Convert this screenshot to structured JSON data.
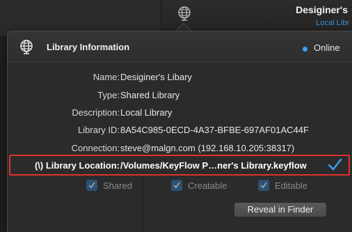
{
  "background_window": {
    "title": "Desiginer's",
    "subtitle": "Local Libr",
    "icon": "globe-icon"
  },
  "popover": {
    "header": {
      "icon": "globe-icon",
      "title": "Library Information",
      "status_text": "Online",
      "status_color": "#3fa0f0"
    },
    "fields": [
      {
        "label": "Name:",
        "value": "Desiginer's Libary"
      },
      {
        "label": "Type:",
        "value": "Shared Library"
      },
      {
        "label": "Description:",
        "value": "Local Library"
      },
      {
        "label": "Library ID:",
        "value": "8A54C985-0ECD-4A37-BFBE-697AF01AC44F"
      },
      {
        "label": "Connection:",
        "value": "steve@malgn.com (192.168.10.205:38317)"
      }
    ],
    "location": {
      "label": "(\\) Library Location:",
      "value": "/Volumes/KeyFlow P…ner's Library.keyflow",
      "highlight_color": "#e0312b"
    },
    "checkboxes": [
      {
        "label": "Shared",
        "checked": true
      },
      {
        "label": "Creatable",
        "checked": true
      },
      {
        "label": "Editable",
        "checked": true
      }
    ],
    "reveal_button": "Reveal in Finder"
  }
}
